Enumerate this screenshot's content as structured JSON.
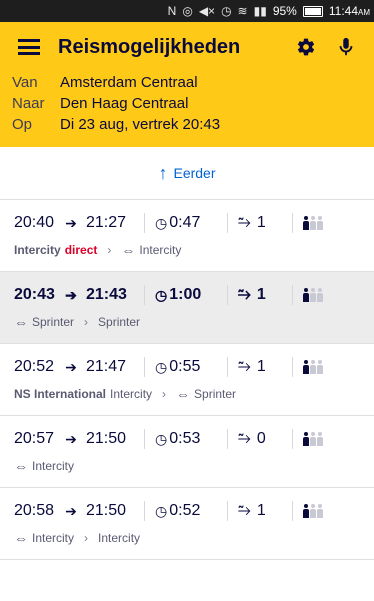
{
  "status_bar": {
    "battery": "95%",
    "time": "11:44",
    "ampm": "AM"
  },
  "toolbar": {
    "title": "Reismogelijkheden",
    "icons": [
      "menu-icon",
      "settings-gear-icon",
      "microphone-icon"
    ]
  },
  "route": {
    "from_label": "Van",
    "from_value": "Amsterdam Centraal",
    "to_label": "Naar",
    "to_value": "Den Haag Centraal",
    "when_label": "Op",
    "when_value": "Di 23 aug, vertrek 20:43"
  },
  "earlier": {
    "label": "Eerder"
  },
  "trips": [
    {
      "dep": "20:40",
      "arr": "21:27",
      "duration": "0:47",
      "transfers": "1",
      "crowd_level": 1,
      "selected": false,
      "legs": {
        "part1_bold": "Intercity",
        "part1_extra": "direct",
        "part2": "Intercity"
      }
    },
    {
      "dep": "20:43",
      "arr": "21:43",
      "duration": "1:00",
      "transfers": "1",
      "crowd_level": 1,
      "selected": true,
      "legs": {
        "part1": "Sprinter",
        "part2": "Sprinter"
      }
    },
    {
      "dep": "20:52",
      "arr": "21:47",
      "duration": "0:55",
      "transfers": "1",
      "crowd_level": 1,
      "selected": false,
      "legs": {
        "part1_bold": "NS International",
        "part1_extra": "Intercity",
        "part2": "Sprinter"
      }
    },
    {
      "dep": "20:57",
      "arr": "21:50",
      "duration": "0:53",
      "transfers": "0",
      "crowd_level": 1,
      "selected": false,
      "legs": {
        "part1": "Intercity"
      }
    },
    {
      "dep": "20:58",
      "arr": "21:50",
      "duration": "0:52",
      "transfers": "1",
      "crowd_level": 1,
      "selected": false,
      "legs": {
        "part1": "Intercity",
        "part2": "Intercity"
      }
    }
  ],
  "colors": {
    "header": "#ffc917",
    "link": "#0063d3",
    "direct": "#db0029",
    "text": "#0a0a3c"
  }
}
